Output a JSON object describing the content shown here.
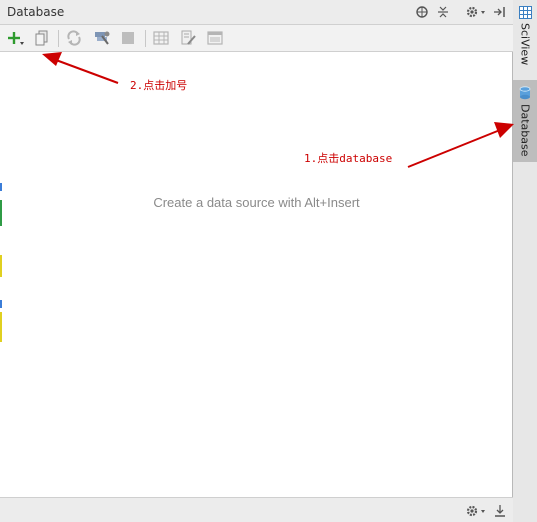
{
  "panel": {
    "title": "Database",
    "empty_message": "Create a data source with Alt+Insert"
  },
  "title_bar_icons": [
    "globe-icon",
    "collapse-icon",
    "gear-icon",
    "hide-panel-icon"
  ],
  "toolbar": {
    "buttons": [
      "add-icon",
      "copy-icon",
      "refresh-icon",
      "configure-icon",
      "stop-icon",
      "table-icon",
      "edit-source-icon",
      "console-icon"
    ]
  },
  "side_tabs": {
    "sciview_label": "SciView",
    "database_label": "Database"
  },
  "annotations": {
    "step1": "1.点击database",
    "step2": "2.点击加号",
    "color": "#cc0000"
  },
  "colors": {
    "add_icon": "#2e9b2e",
    "annotation": "#cc0000",
    "active_tab": "#bdbdbd"
  }
}
